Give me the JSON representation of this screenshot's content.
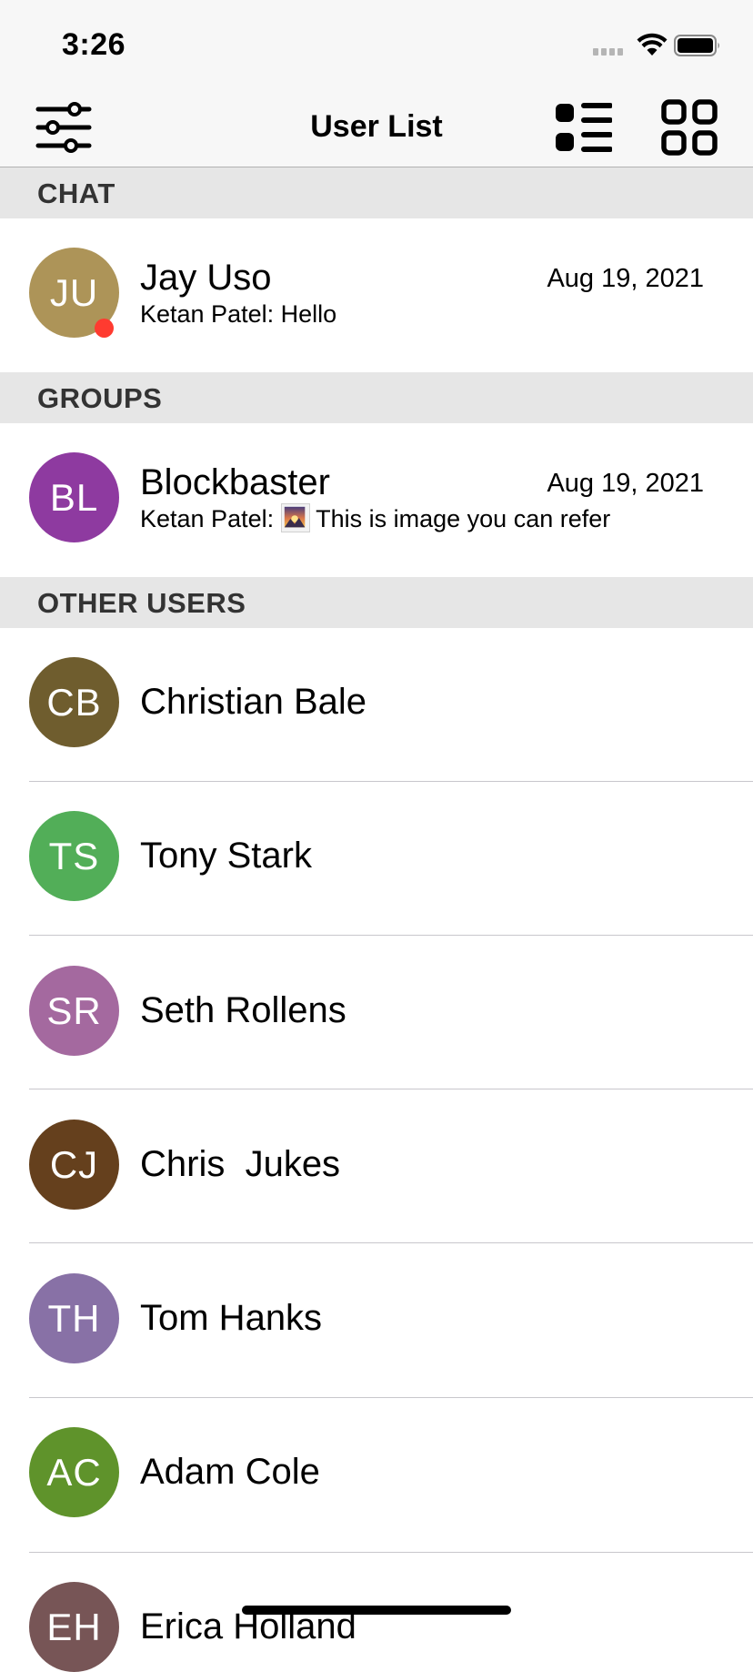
{
  "status_bar": {
    "time": "3:26",
    "icons": [
      "cellular-signal-icon",
      "wifi-icon",
      "battery-icon"
    ]
  },
  "nav": {
    "title": "User List",
    "left_icon": "filter-sliders-icon",
    "right_icons": [
      "list-view-icon",
      "grid-view-icon"
    ]
  },
  "sections": {
    "chat": "CHAT",
    "groups": "GROUPS",
    "other_users": "OTHER USERS"
  },
  "chats": [
    {
      "initials": "JU",
      "name": "Jay Uso",
      "date": "Aug 19, 2021",
      "preview_sender": "Ketan Patel:",
      "preview_text": "Hello",
      "online": true,
      "color": "#ad9458"
    }
  ],
  "groups": [
    {
      "initials": "BL",
      "name": "Blockbaster",
      "date": "Aug 19, 2021",
      "preview_sender": "Ketan Patel:",
      "preview_icon": "image-thumbnail-icon",
      "preview_text": "This is image you can refer",
      "color": "#8e3aa0"
    }
  ],
  "other_users": [
    {
      "initials": "CB",
      "name": "Christian Bale",
      "color": "#6f5d2e"
    },
    {
      "initials": "TS",
      "name": "Tony Stark",
      "color": "#52ae58"
    },
    {
      "initials": "SR",
      "name": "Seth Rollens",
      "color": "#a4699f"
    },
    {
      "initials": "CJ",
      "name": "Chris  Jukes",
      "color": "#65401d"
    },
    {
      "initials": "TH",
      "name": "Tom Hanks",
      "color": "#8871a6"
    },
    {
      "initials": "AC",
      "name": "Adam Cole",
      "color": "#5f932b"
    },
    {
      "initials": "EH",
      "name": "Erica Holland",
      "color": "#775556"
    }
  ]
}
